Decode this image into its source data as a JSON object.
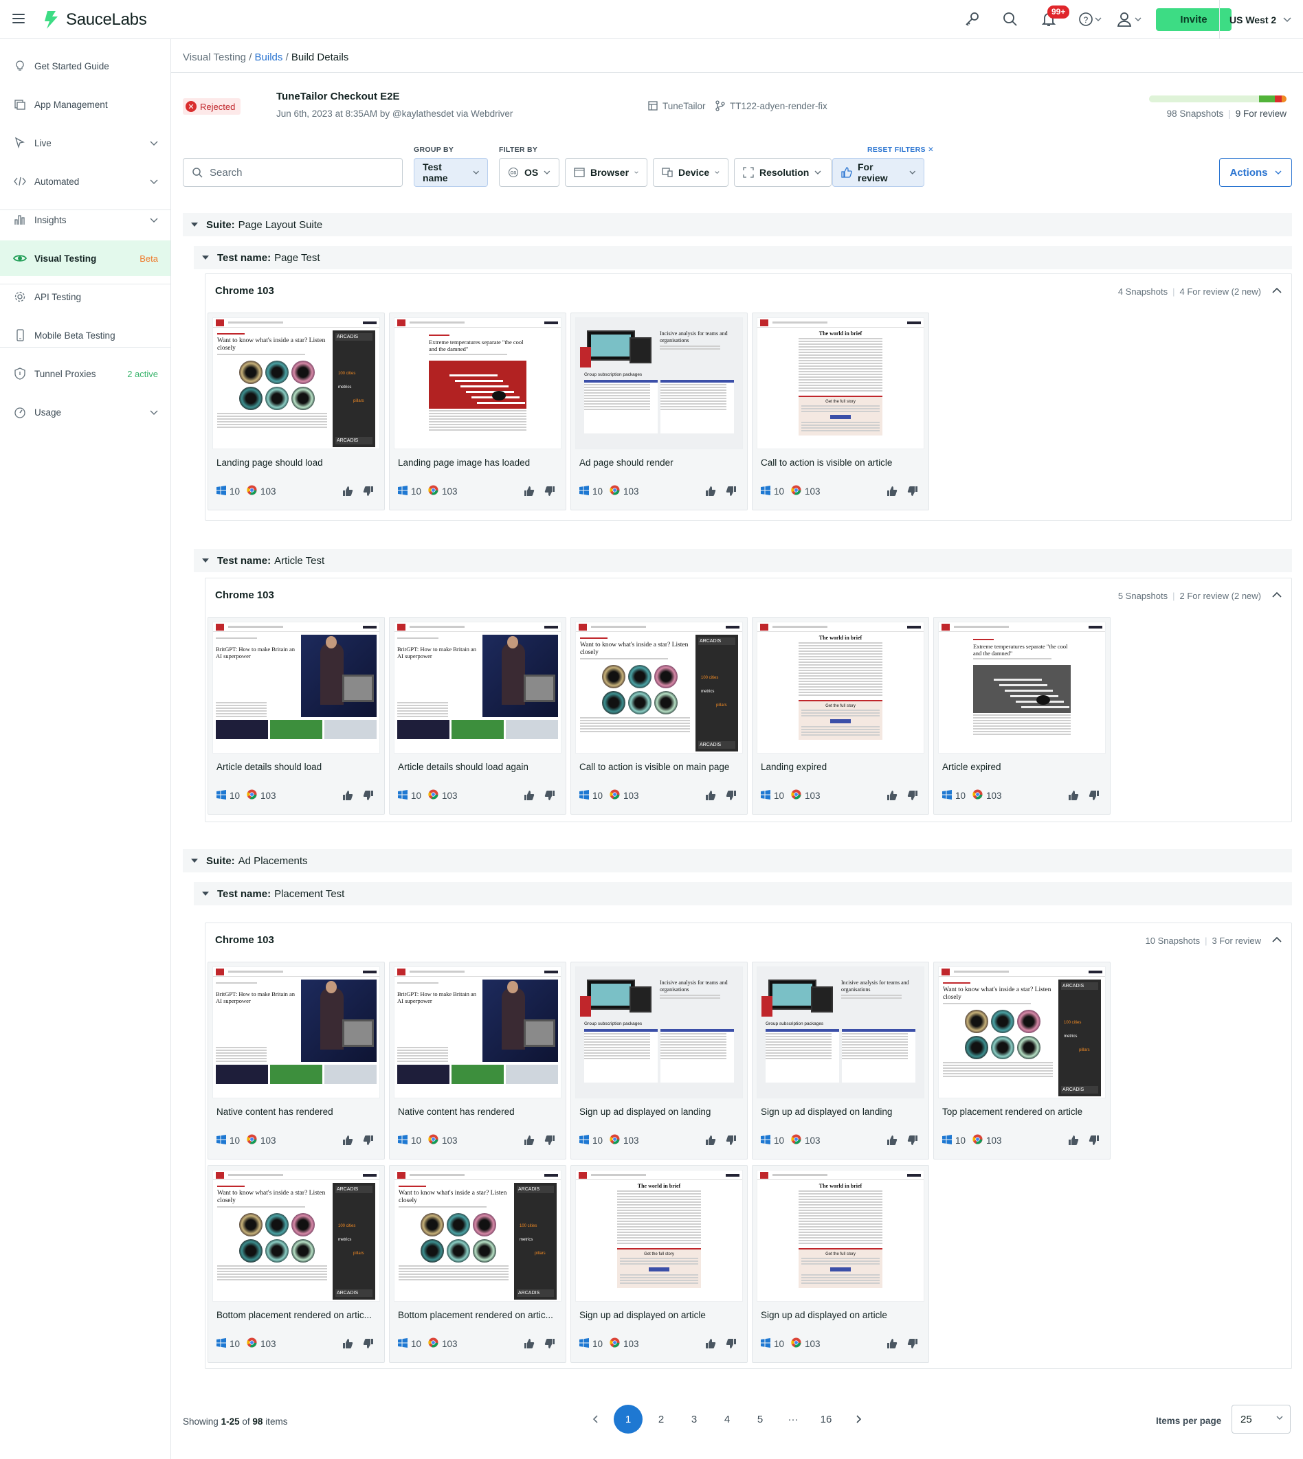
{
  "app": {
    "brand": "SauceLabs",
    "notification_count": "99+",
    "invite_label": "Invite",
    "region": "US West 2"
  },
  "sidebar": {
    "items": [
      {
        "label": "Get Started Guide",
        "icon": "bulb-icon",
        "right": ""
      },
      {
        "label": "App Management",
        "icon": "app-icon",
        "right": ""
      },
      {
        "label": "Live",
        "icon": "cursor-icon",
        "right": ""
      },
      {
        "label": "Automated",
        "icon": "code-icon",
        "right": ""
      },
      {
        "label": "Insights",
        "icon": "bar-chart-icon",
        "right": ""
      },
      {
        "label": "Visual Testing",
        "icon": "eye-icon",
        "right": "Beta"
      },
      {
        "label": "API Testing",
        "icon": "gear-icon",
        "right": ""
      },
      {
        "label": "Mobile Beta Testing",
        "icon": "phone-icon",
        "right": ""
      },
      {
        "label": "Tunnel Proxies",
        "icon": "shield-icon",
        "right": "2 active"
      },
      {
        "label": "Usage",
        "icon": "gauge-icon",
        "right": ""
      }
    ]
  },
  "breadcrumb": {
    "root": "Visual Testing",
    "link": "Builds",
    "current": "Build Details",
    "sep": "/"
  },
  "build": {
    "status": "Rejected",
    "title": "TuneTailor Checkout E2E",
    "subtitle": "Jun 6th, 2023 at 8:35AM by @kaylathesdet via Webdriver",
    "project": "TuneTailor",
    "branch": "TT122-adyen-render-fix",
    "snapshots": "98 Snapshots",
    "for_review": "9 For review",
    "progress": {
      "approved": 0.44,
      "unreviewed_green": 0.2,
      "rejected": 0.04,
      "changed": 0.03,
      "review": 0.09
    }
  },
  "filters": {
    "search_placeholder": "Search",
    "group_by_label": "GROUP BY",
    "filter_by_label": "FILTER BY",
    "group_by_value": "Test name",
    "os": "OS",
    "browser": "Browser",
    "device": "Device",
    "resolution": "Resolution",
    "for_review": "For review",
    "reset": "RESET FILTERS",
    "actions": "Actions"
  },
  "labels": {
    "suite_prefix": "Suite:",
    "test_prefix": "Test name:",
    "os_version": "10",
    "browser_version": "103"
  },
  "suites": [
    {
      "name": "Page Layout Suite",
      "tests": [
        {
          "name": "Page Test",
          "panel": {
            "title": "Chrome 103",
            "snapshots": "4 Snapshots",
            "review": "4 For review (2 new)"
          },
          "cards": [
            {
              "caption": "Landing page should load",
              "kind": "stars"
            },
            {
              "caption": "Landing page image has loaded",
              "kind": "stairs"
            },
            {
              "caption": "Ad page should render",
              "kind": "ad"
            },
            {
              "caption": "Call to action is visible on article",
              "kind": "brief"
            }
          ]
        },
        {
          "name": "Article Test",
          "panel": {
            "title": "Chrome 103",
            "snapshots": "5 Snapshots",
            "review": "2 For review (2 new)"
          },
          "cards": [
            {
              "caption": "Article details should load",
              "kind": "britgpt"
            },
            {
              "caption": "Article details should load again",
              "kind": "britgpt"
            },
            {
              "caption": "Call to action is visible on main page",
              "kind": "stars"
            },
            {
              "caption": "Landing expired",
              "kind": "brief"
            },
            {
              "caption": "Article expired",
              "kind": "stairs-gray"
            }
          ]
        }
      ]
    },
    {
      "name": "Ad Placements",
      "tests": [
        {
          "name": "Placement Test",
          "panel": {
            "title": "Chrome 103",
            "snapshots": "10 Snapshots",
            "review": "3 For review"
          },
          "cards": [
            {
              "caption": "Native content has rendered",
              "kind": "britgpt"
            },
            {
              "caption": "Native content has rendered",
              "kind": "britgpt"
            },
            {
              "caption": "Sign up ad displayed on landing",
              "kind": "ad"
            },
            {
              "caption": "Sign up ad displayed on landing",
              "kind": "ad"
            },
            {
              "caption": "Top placement rendered on article",
              "kind": "stars"
            },
            {
              "caption": "Bottom placement rendered on artic...",
              "kind": "stars"
            },
            {
              "caption": "Bottom placement rendered on artic...",
              "kind": "stars"
            },
            {
              "caption": "Sign up ad displayed on article",
              "kind": "brief"
            },
            {
              "caption": "Sign up ad displayed on article",
              "kind": "brief"
            }
          ]
        }
      ]
    }
  ],
  "thumb_text": {
    "stars_head": "Want to know what's inside a star? Listen closely",
    "stairs_head": "Extreme temperatures separate \"the cool and the damned\"",
    "ad_head": "Incisive analysis for teams and organisations",
    "ad_sub": "Group subscription packages",
    "brief_head": "The world in brief",
    "brief_cta": "Get the full story",
    "britgpt_head": "BritGPT: How to make Britain an AI superpower",
    "sponsor": "ARCADIS"
  },
  "footer": {
    "showing_prefix": "Showing",
    "showing_range": "1-25",
    "showing_of": "of",
    "showing_total": "98",
    "showing_suffix": "items",
    "pages": [
      "1",
      "2",
      "3",
      "4",
      "5",
      "···",
      "16"
    ],
    "items_per_page_label": "Items per page",
    "items_per_page": "25"
  }
}
